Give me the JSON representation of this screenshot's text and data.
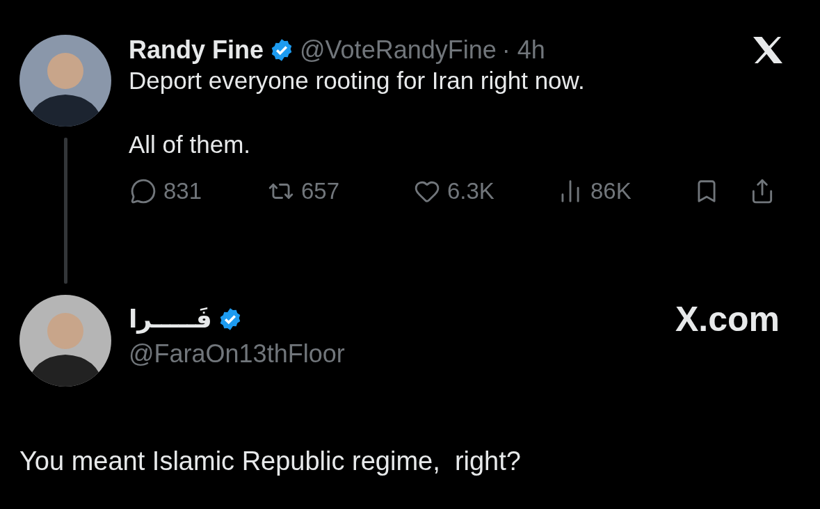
{
  "tweet": {
    "author": {
      "name": "Randy Fine",
      "verified": true,
      "handle": "@VoteRandyFine",
      "time": "· 4h"
    },
    "text_lines": [
      "Deport everyone rooting for Iran right now.",
      "All of them."
    ],
    "actions": [
      {
        "kind": "reply",
        "count": "831"
      },
      {
        "kind": "repost",
        "count": "657"
      },
      {
        "kind": "like",
        "count": "6.3K"
      },
      {
        "kind": "views",
        "count": "86K"
      },
      {
        "kind": "bookmark"
      },
      {
        "kind": "share"
      }
    ]
  },
  "reply": {
    "author": {
      "name": "فَـــــرا",
      "verified": true,
      "handle": "@FaraOn13thFloor"
    },
    "site": "X.com",
    "text": "You meant Islamic Republic regime,  right?"
  }
}
